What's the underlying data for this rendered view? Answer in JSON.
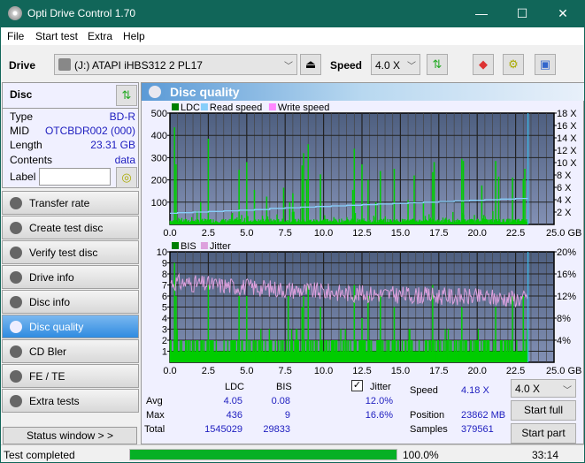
{
  "window": {
    "title": "Opti Drive Control 1.70",
    "minimize": "—",
    "maximize": "☐",
    "close": "✕"
  },
  "menu": [
    "File",
    "Start test",
    "Extra",
    "Help"
  ],
  "toolbar": {
    "drive_label": "Drive",
    "drive_value": "(J:)  ATAPI iHBS312  2 PL17",
    "speed_label": "Speed",
    "speed_value": "4.0 X",
    "eject_icon": "eject-icon",
    "refresh_icon": "refresh-icon",
    "erase_icon": "eraser-icon",
    "settings_icon": "gears-icon",
    "save_icon": "save-icon"
  },
  "disc": {
    "header": "Disc",
    "rows": [
      {
        "label": "Type",
        "value": "BD-R"
      },
      {
        "label": "MID",
        "value": "OTCBDR002 (000)"
      },
      {
        "label": "Length",
        "value": "23.31 GB"
      },
      {
        "label": "Contents",
        "value": "data"
      }
    ],
    "label_field": "Label",
    "label_value": ""
  },
  "nav": [
    {
      "label": "Transfer rate"
    },
    {
      "label": "Create test disc"
    },
    {
      "label": "Verify test disc"
    },
    {
      "label": "Drive info"
    },
    {
      "label": "Disc info"
    },
    {
      "label": "Disc quality",
      "active": true
    },
    {
      "label": "CD Bler"
    },
    {
      "label": "FE / TE"
    },
    {
      "label": "Extra tests"
    }
  ],
  "status_window": "Status window > >",
  "panel_title": "Disc quality",
  "chart_data": [
    {
      "type": "bar",
      "title": "LDC",
      "legend": [
        "LDC",
        "Read speed",
        "Write speed"
      ],
      "legend_colors": [
        "#008000",
        "#87cefa",
        "#ff88ff"
      ],
      "xlabel": "GB",
      "xlim": [
        0,
        25
      ],
      "ylim": [
        0,
        500
      ],
      "y2lim": [
        0,
        18
      ],
      "x_ticks": [
        "0.0",
        "2.5",
        "5.0",
        "7.5",
        "10.0",
        "12.5",
        "15.0",
        "17.5",
        "20.0",
        "22.5",
        "25.0 GB"
      ],
      "y_ticks": [
        "100",
        "200",
        "300",
        "400",
        "500"
      ],
      "y2_ticks": [
        "2 X",
        "4 X",
        "6 X",
        "8 X",
        "10 X",
        "12 X",
        "14 X",
        "16 X",
        "18 X"
      ],
      "ldc_spikes": [
        [
          0.3,
          436
        ],
        [
          0.4,
          270
        ],
        [
          2.0,
          100
        ],
        [
          2.5,
          385
        ],
        [
          4.5,
          245
        ],
        [
          5.0,
          280
        ],
        [
          5.5,
          155
        ],
        [
          6.3,
          125
        ],
        [
          7.4,
          165
        ],
        [
          7.8,
          100
        ],
        [
          8.0,
          140
        ],
        [
          8.6,
          265
        ],
        [
          8.7,
          320
        ],
        [
          8.9,
          200
        ],
        [
          9.0,
          360
        ],
        [
          9.8,
          225
        ],
        [
          11.9,
          155
        ],
        [
          12.0,
          340
        ],
        [
          12.5,
          270
        ],
        [
          12.9,
          200
        ],
        [
          13.4,
          100
        ],
        [
          13.7,
          240
        ],
        [
          14.6,
          250
        ],
        [
          15.5,
          110
        ],
        [
          15.9,
          220
        ],
        [
          16.5,
          100
        ],
        [
          17.1,
          235
        ],
        [
          17.2,
          280
        ],
        [
          19.0,
          295
        ],
        [
          19.1,
          285
        ],
        [
          20.3,
          175
        ],
        [
          21.2,
          285
        ],
        [
          21.4,
          215
        ],
        [
          22.3,
          210
        ],
        [
          23.0,
          205
        ],
        [
          23.1,
          250
        ]
      ],
      "read_speed_x": [
        0,
        0.5,
        1.5,
        2.5,
        3.5,
        4.5,
        5.5,
        6.5,
        7.5,
        8.5,
        9.5,
        10.5,
        11.5,
        12.5,
        13.5,
        14.5,
        15.5,
        16.5,
        17.5,
        18.5,
        19.5,
        20.5,
        21.5,
        22.5,
        23.3
      ],
      "read_speed_y": [
        1.8,
        1.9,
        2.0,
        2.1,
        2.2,
        2.3,
        2.4,
        2.6,
        2.7,
        2.8,
        2.9,
        3.0,
        3.1,
        3.2,
        3.3,
        3.4,
        3.5,
        3.6,
        3.7,
        3.8,
        3.9,
        4.0,
        4.1,
        4.2,
        4.3
      ],
      "end_position": 23.31
    },
    {
      "type": "bar",
      "title": "BIS",
      "legend": [
        "BIS",
        "Jitter"
      ],
      "legend_colors": [
        "#008000",
        "#dda0dd"
      ],
      "xlabel": "GB",
      "xlim": [
        0,
        25
      ],
      "ylim": [
        0,
        10
      ],
      "y2lim": [
        0,
        20
      ],
      "x_ticks": [
        "0.0",
        "2.5",
        "5.0",
        "7.5",
        "10.0",
        "12.5",
        "15.0",
        "17.5",
        "20.0",
        "22.5",
        "25.0 GB"
      ],
      "y_ticks": [
        "1",
        "2",
        "3",
        "4",
        "5",
        "6",
        "7",
        "8",
        "9",
        "10"
      ],
      "y2_ticks": [
        "4%",
        "8%",
        "12%",
        "16%",
        "20%"
      ],
      "bis_spikes": [
        [
          0.3,
          9
        ],
        [
          0.4,
          6
        ],
        [
          2.5,
          7
        ],
        [
          4.5,
          6
        ],
        [
          5.0,
          6
        ],
        [
          7.7,
          6
        ],
        [
          8.6,
          5
        ],
        [
          8.7,
          6
        ],
        [
          9.0,
          7
        ],
        [
          9.8,
          5
        ],
        [
          12.0,
          7
        ],
        [
          12.5,
          4
        ],
        [
          12.9,
          6
        ],
        [
          13.7,
          6
        ],
        [
          14.6,
          5
        ],
        [
          17.1,
          7
        ],
        [
          19.0,
          5
        ],
        [
          21.2,
          5
        ],
        [
          22.3,
          6
        ],
        [
          23.0,
          6
        ]
      ],
      "jitter_start": 14.5,
      "jitter_mid": 12.5,
      "jitter_end": 11.5,
      "end_position": 23.31
    }
  ],
  "stats": {
    "col_ldc": "LDC",
    "col_bis": "BIS",
    "jitter_label": "Jitter",
    "jitter_checked": true,
    "rows": [
      {
        "label": "Avg",
        "ldc": "4.05",
        "bis": "0.08",
        "jitter": "12.0%"
      },
      {
        "label": "Max",
        "ldc": "436",
        "bis": "9",
        "jitter": "16.6%"
      },
      {
        "label": "Total",
        "ldc": "1545029",
        "bis": "29833",
        "jitter": ""
      }
    ],
    "speed_label": "Speed",
    "speed_value": "4.18 X",
    "position_label": "Position",
    "position_value": "23862 MB",
    "samples_label": "Samples",
    "samples_value": "379561",
    "speed_select": "4.0 X",
    "start_full": "Start full",
    "start_part": "Start part"
  },
  "statusbar": {
    "text": "Test completed",
    "progress": 100.0,
    "progress_text": "100.0%",
    "time": "33:14"
  }
}
